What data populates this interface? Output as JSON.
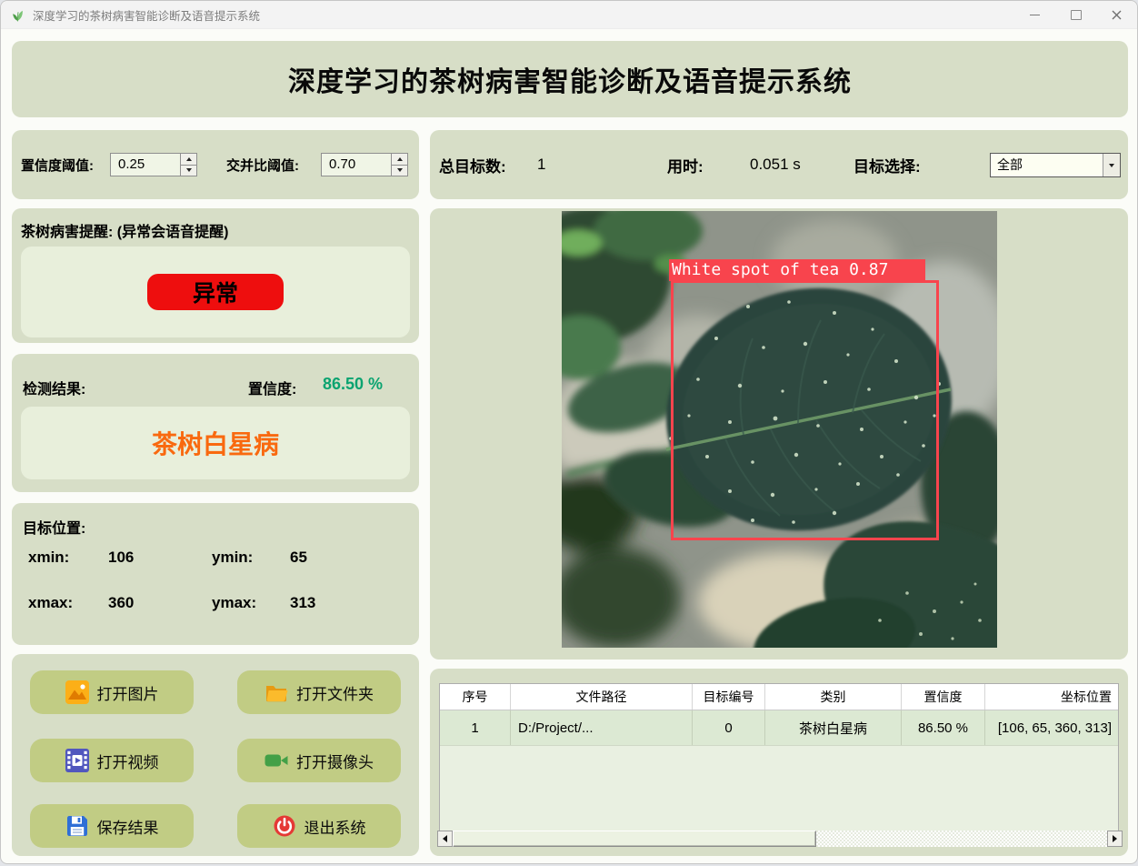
{
  "window": {
    "title": "深度学习的茶树病害智能诊断及语音提示系统"
  },
  "header": {
    "title": "深度学习的茶树病害智能诊断及语音提示系统"
  },
  "thresholds": {
    "conf_label": "置信度阈值:",
    "conf_value": "0.25",
    "iou_label": "交并比阈值:",
    "iou_value": "0.70"
  },
  "stats": {
    "total_label": "总目标数:",
    "total_value": "1",
    "time_label": "用时:",
    "time_value": "0.051 s",
    "target_select_label": "目标选择:",
    "target_select_value": "全部"
  },
  "alert": {
    "title": "茶树病害提醒: (异常会语音提醒)",
    "status": "异常"
  },
  "result": {
    "label": "检测结果:",
    "confidence_label": "置信度:",
    "confidence_value": "86.50 %",
    "disease_name": "茶树白星病"
  },
  "position": {
    "title": "目标位置:",
    "xmin_label": "xmin:",
    "xmin_value": "106",
    "ymin_label": "ymin:",
    "ymin_value": "65",
    "xmax_label": "xmax:",
    "xmax_value": "360",
    "ymax_label": "ymax:",
    "ymax_value": "313"
  },
  "buttons": {
    "open_image": "打开图片",
    "open_folder": "打开文件夹",
    "open_video": "打开视频",
    "open_camera": "打开摄像头",
    "save_result": "保存结果",
    "exit_system": "退出系统"
  },
  "viewer": {
    "bbox_label": "White spot of tea 0.87"
  },
  "table": {
    "headers": [
      "序号",
      "文件路径",
      "目标编号",
      "类别",
      "置信度",
      "坐标位置"
    ],
    "rows": [
      [
        "1",
        "D:/Project/...",
        "0",
        "茶树白星病",
        "86.50 %",
        "[106, 65, 360, 313]"
      ]
    ]
  },
  "colors": {
    "panel": "#D7DEC7",
    "inner_panel": "#E8EFDB",
    "button": "#C1CC84",
    "alert_red": "#EE0E0E",
    "disease_orange": "#F9690F",
    "confidence_green": "#0AA370",
    "bbox_red": "#F8444D"
  }
}
